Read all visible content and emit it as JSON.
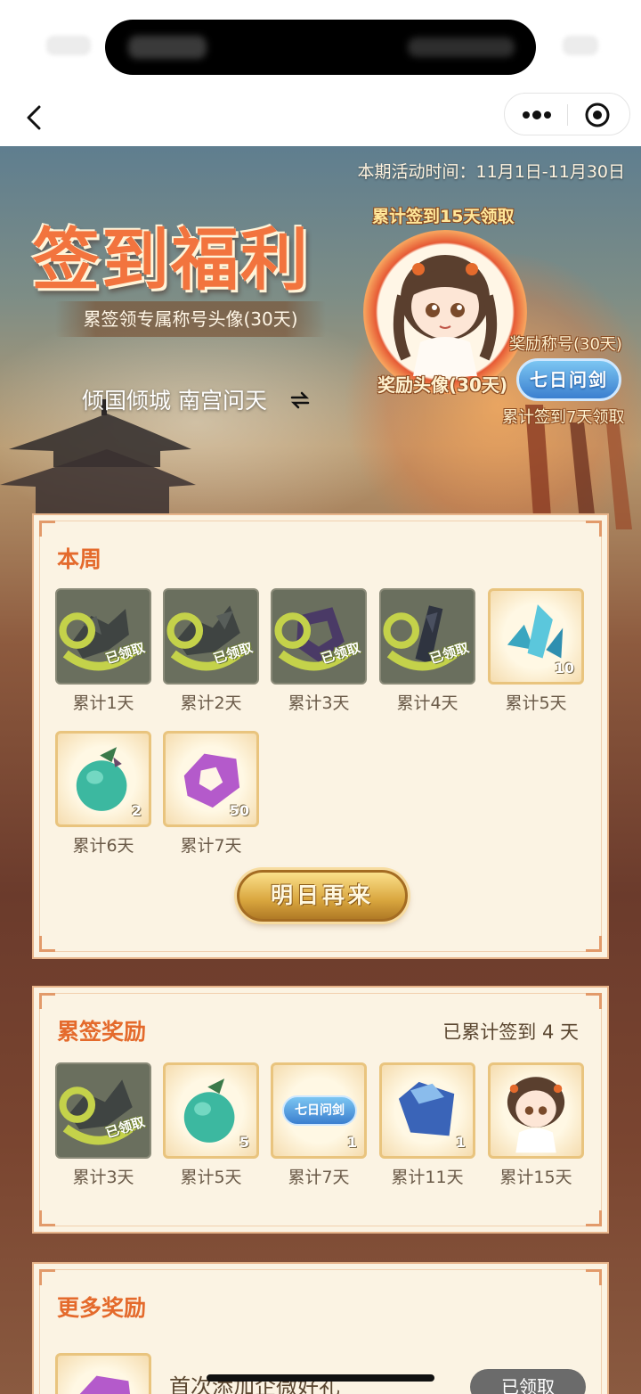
{
  "page": {
    "activity_period": "本期活动时间：11月1日-11月30日",
    "banner_title": "签到福利",
    "banner_subtitle": "累签领专属称号头像(30天)",
    "title_switch": "倾国倾城 南宫问天",
    "reward15_label": "累计签到15天领取",
    "avatar_reward_label": "奖励头像(30天)",
    "title_reward_label": "奖励称号(30天)",
    "title_badge": "七日问剑",
    "reward7_label": "累计签到7天领取"
  },
  "weekly": {
    "title": "本周",
    "claimed_text": "已领取",
    "button": "明日再来",
    "items": [
      {
        "label": "累计1天",
        "icon": "gray-shard-icon",
        "claimed": true
      },
      {
        "label": "累计2天",
        "icon": "gray-shard-icon",
        "claimed": true
      },
      {
        "label": "累计3天",
        "icon": "purple-ring-icon",
        "claimed": true
      },
      {
        "label": "累计4天",
        "icon": "dark-crystal-icon",
        "claimed": true
      },
      {
        "label": "累计5天",
        "icon": "blue-crystal-icon",
        "qty": "10"
      },
      {
        "label": "累计6天",
        "icon": "jade-pouch-icon",
        "qty": "2"
      },
      {
        "label": "累计7天",
        "icon": "purple-ring-icon",
        "qty": "50"
      }
    ]
  },
  "cumulative": {
    "title": "累签奖励",
    "progress_text": "已累计签到 4 天",
    "items": [
      {
        "label": "累计3天",
        "icon": "gray-shard-icon",
        "claimed": true
      },
      {
        "label": "累计5天",
        "icon": "jade-pouch-icon",
        "qty": "5"
      },
      {
        "label": "累计7天",
        "icon": "title-badge-icon",
        "badge_text": "七日问剑",
        "qty": "1"
      },
      {
        "label": "累计11天",
        "icon": "blue-scroll-icon",
        "qty": "1"
      },
      {
        "label": "累计15天",
        "icon": "avatar-chibi-icon"
      }
    ]
  },
  "more": {
    "title": "更多奖励",
    "first_item_text": "首次添加企微好礼",
    "first_item_button": "已领取"
  },
  "colors": {
    "accent": "#e46a2c",
    "card_bg": "#fbf3e3",
    "badge_blue": "#3b7fcf",
    "gold": "#d9a63e"
  }
}
